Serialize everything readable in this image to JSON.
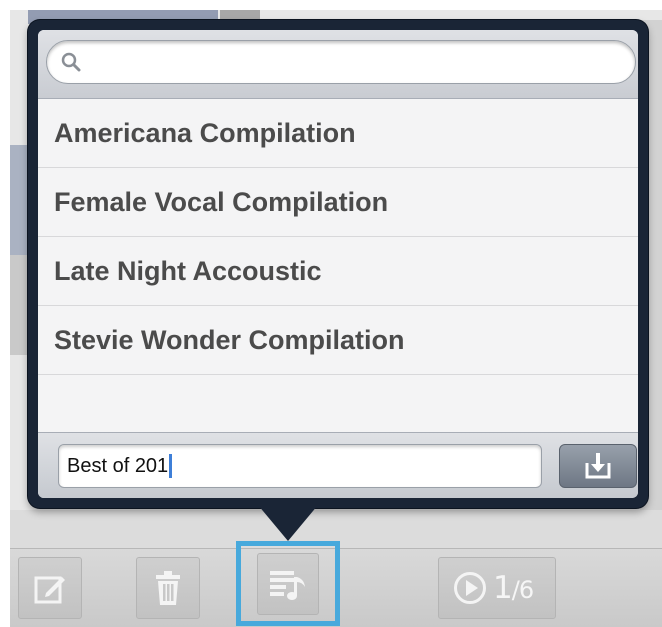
{
  "search": {
    "placeholder": "",
    "icon": "search-icon"
  },
  "playlists": [
    {
      "label": "Americana Compilation"
    },
    {
      "label": "Female Vocal Compilation"
    },
    {
      "label": "Late Night Accoustic"
    },
    {
      "label": "Stevie Wonder Compilation"
    }
  ],
  "new_playlist": {
    "value": "Best of 201",
    "save_icon": "save-to-playlist-icon"
  },
  "toolbar": {
    "edit_icon": "edit-icon",
    "trash_icon": "trash-icon",
    "playlist_icon": "playlist-icon",
    "play_icon": "play-icon",
    "page_current": "1",
    "page_separator": "/",
    "page_total": "6"
  },
  "colors": {
    "popover": "#1a2536",
    "selection_highlight": "#47a9dc",
    "list_text": "#4b4b4b"
  }
}
